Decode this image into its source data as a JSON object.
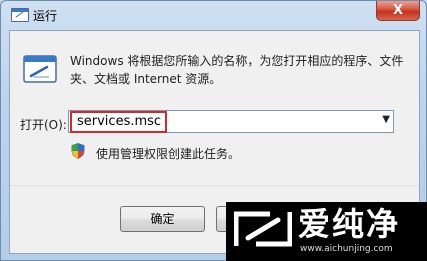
{
  "window": {
    "title": "运行",
    "close_glyph": "X"
  },
  "description": "Windows 将根据您所输入的名称，为您打开相应的程序、文件夹、文档或 Internet 资源。",
  "open_field": {
    "label": "打开(O):",
    "value": "services.msc"
  },
  "admin_note": "使用管理权限创建此任务。",
  "buttons": {
    "ok": "确定"
  },
  "watermark": {
    "text": "爱纯净",
    "url": "www.aichunjing.com"
  },
  "colors": {
    "highlight": "#d9262b",
    "close": "#c4311a"
  },
  "icons": [
    "run-app-icon",
    "run-dialog-icon",
    "uac-shield-icon",
    "dropdown-arrow-icon",
    "watermark-logo-icon"
  ]
}
